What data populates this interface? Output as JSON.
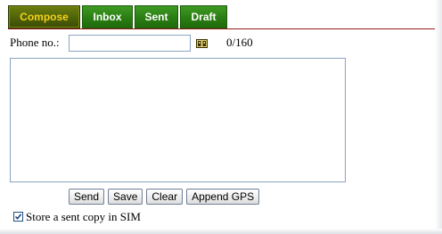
{
  "tabs": [
    {
      "label": "Compose",
      "active": true
    },
    {
      "label": "Inbox",
      "active": false
    },
    {
      "label": "Sent",
      "active": false
    },
    {
      "label": "Draft",
      "active": false
    }
  ],
  "compose": {
    "phone_label": "Phone no.:",
    "phone_value": "",
    "contacts_icon": "address-book-icon",
    "char_counter": "0/160",
    "message_value": ""
  },
  "actions": {
    "send_label": "Send",
    "save_label": "Save",
    "clear_label": "Clear",
    "append_gps_label": "Append GPS"
  },
  "options": {
    "store_copy_label": "Store a sent copy in SIM",
    "store_copy_checked": true
  },
  "colors": {
    "tab_green": "#2a7d12",
    "tab_active": "#4f6209",
    "tab_active_text": "#f4d21a",
    "rule_red": "#9a1b1b",
    "field_border": "#8aa3bf"
  }
}
